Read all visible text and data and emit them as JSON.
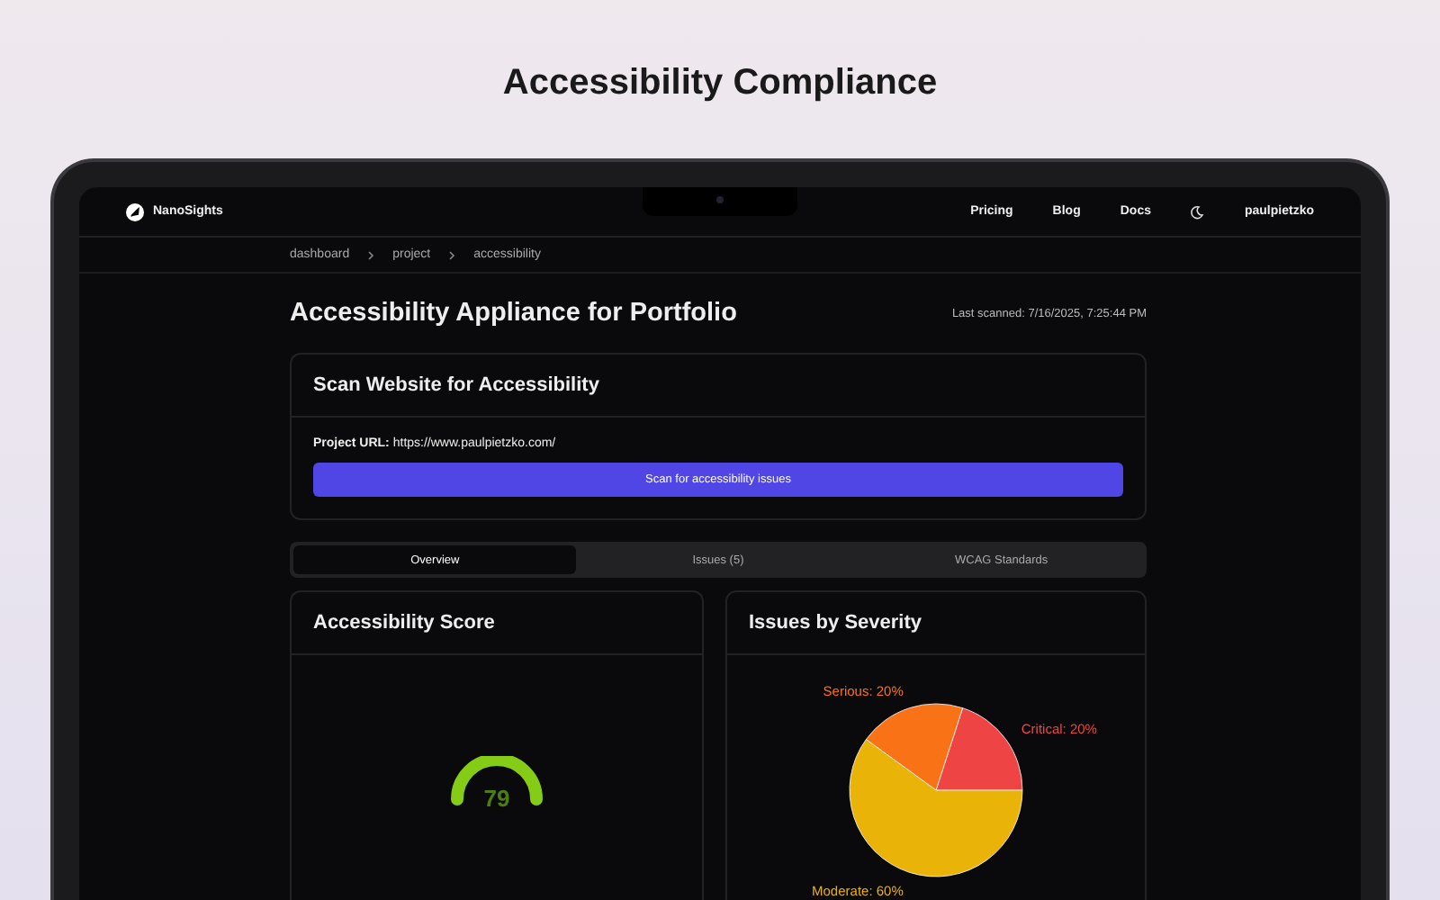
{
  "page_title": "Accessibility Compliance",
  "nav": {
    "brand": "NanoSights",
    "links": [
      "Pricing",
      "Blog",
      "Docs"
    ],
    "user": "paulpietzko"
  },
  "breadcrumb": [
    "dashboard",
    "project",
    "accessibility"
  ],
  "header": {
    "title": "Accessibility Appliance for Portfolio",
    "last_scanned": "Last scanned: 7/16/2025, 7:25:44 PM"
  },
  "scan_card": {
    "title": "Scan Website for Accessibility",
    "url_label": "Project URL:",
    "url": "https://www.paulpietzko.com/",
    "button": "Scan for accessibility issues"
  },
  "tabs": [
    {
      "label": "Overview",
      "selected": true
    },
    {
      "label": "Issues (5)",
      "selected": false
    },
    {
      "label": "WCAG Standards",
      "selected": false
    }
  ],
  "score_card": {
    "title": "Accessibility Score",
    "score": "79"
  },
  "severity_card": {
    "title": "Issues by Severity",
    "chart_data": {
      "type": "pie",
      "values": [
        20,
        20,
        60
      ],
      "colors": [
        "#ef4444",
        "#f97316",
        "#eab308"
      ],
      "value_labels": [
        "Critical: 20%",
        "Serious: 20%",
        "Moderate: 60%"
      ]
    }
  }
}
